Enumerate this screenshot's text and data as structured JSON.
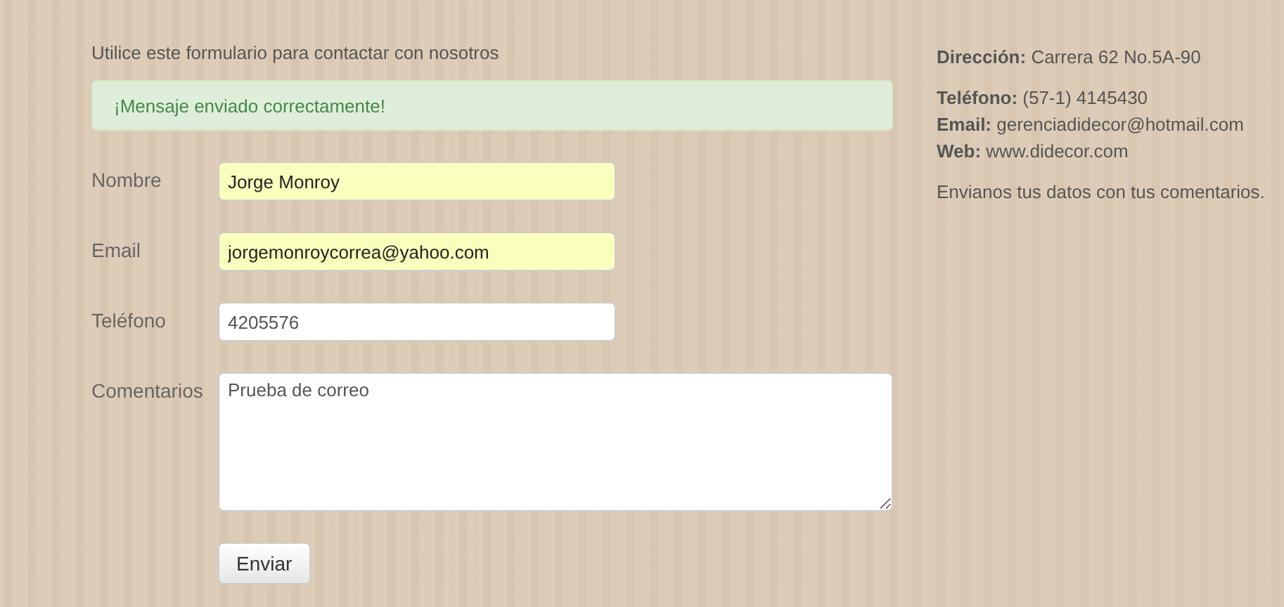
{
  "intro": "Utilice este formulario para contactar con nosotros",
  "alert": {
    "text": "¡Mensaje enviado correctamente!",
    "kind": "success"
  },
  "fields": [
    {
      "label": "Nombre",
      "kind": "input",
      "value": "Jorge Monroy",
      "autofilled": true
    },
    {
      "label": "Email",
      "kind": "input",
      "value": "jorgemonroycorrea@yahoo.com",
      "autofilled": true
    },
    {
      "label": "Teléfono",
      "kind": "input",
      "value": "4205576",
      "autofilled": false
    },
    {
      "label": "Comentarios",
      "kind": "textarea",
      "value": "Prueba de correo",
      "autofilled": false
    }
  ],
  "submit": "Enviar",
  "contact_paragraphs": [
    {
      "lines": [
        "**Dirección:** Carrera 62 No.5A-90"
      ]
    },
    {
      "lines": [
        "**Teléfono:** (57-1) 4145430",
        "**Email:** gerenciadidecor@hotmail.com",
        "**Web:** www.didecor.com"
      ]
    },
    {
      "lines": [
        "Envianos tus datos con tus comentarios."
      ]
    }
  ]
}
